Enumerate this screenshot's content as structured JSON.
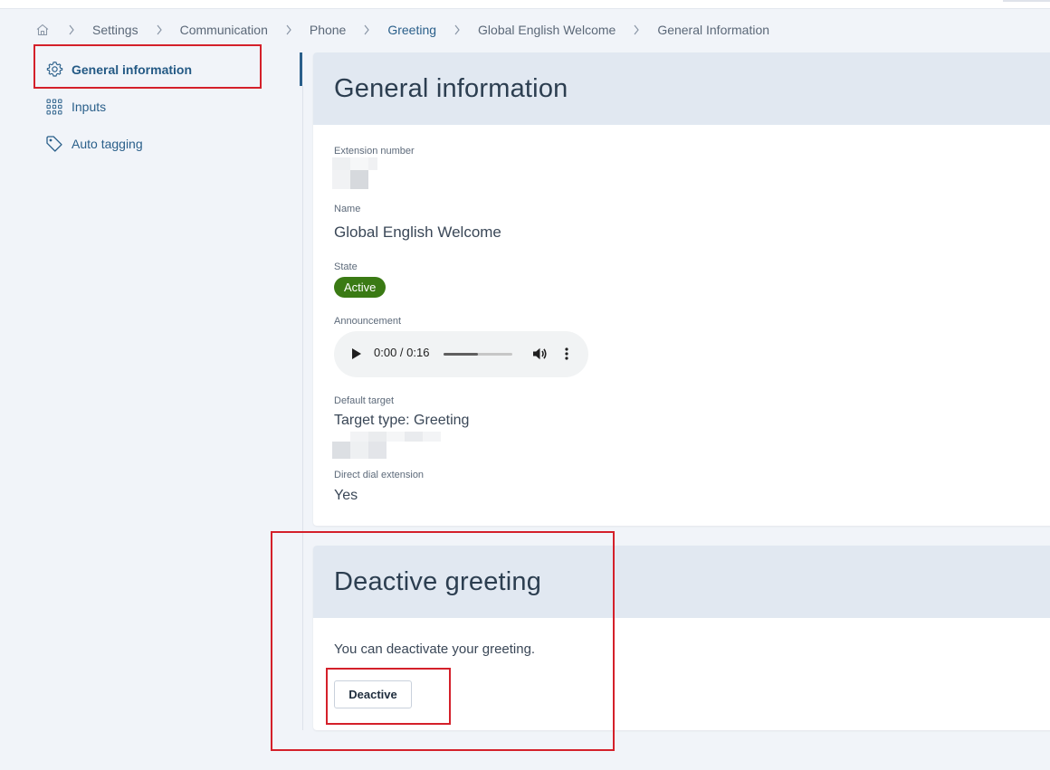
{
  "breadcrumb": {
    "home_icon": "home-icon",
    "items": [
      "Settings",
      "Communication",
      "Phone",
      "Greeting",
      "Global English Welcome",
      "General Information"
    ]
  },
  "sidebar": {
    "items": [
      {
        "label": "General information",
        "icon": "gear-icon",
        "active": true
      },
      {
        "label": "Inputs",
        "icon": "dialpad-icon",
        "active": false
      },
      {
        "label": "Auto tagging",
        "icon": "tag-icon",
        "active": false
      }
    ]
  },
  "general": {
    "title": "General information",
    "extension_label": "Extension number",
    "name_label": "Name",
    "name_value": "Global English Welcome",
    "state_label": "State",
    "state_value": "Active",
    "announcement_label": "Announcement",
    "audio": {
      "time": "0:00 / 0:16",
      "progress": 0.5
    },
    "default_target_label": "Default target",
    "default_target_value": "Target type: Greeting",
    "direct_dial_label": "Direct dial extension",
    "direct_dial_value": "Yes"
  },
  "deactivate": {
    "title": "Deactive greeting",
    "description": "You can deactivate your greeting.",
    "button_label": "Deactive"
  },
  "colors": {
    "accent": "#2a5f8a",
    "active_badge": "#3a7a14",
    "highlight": "#d4202a",
    "card_header": "#e1e8f1"
  }
}
